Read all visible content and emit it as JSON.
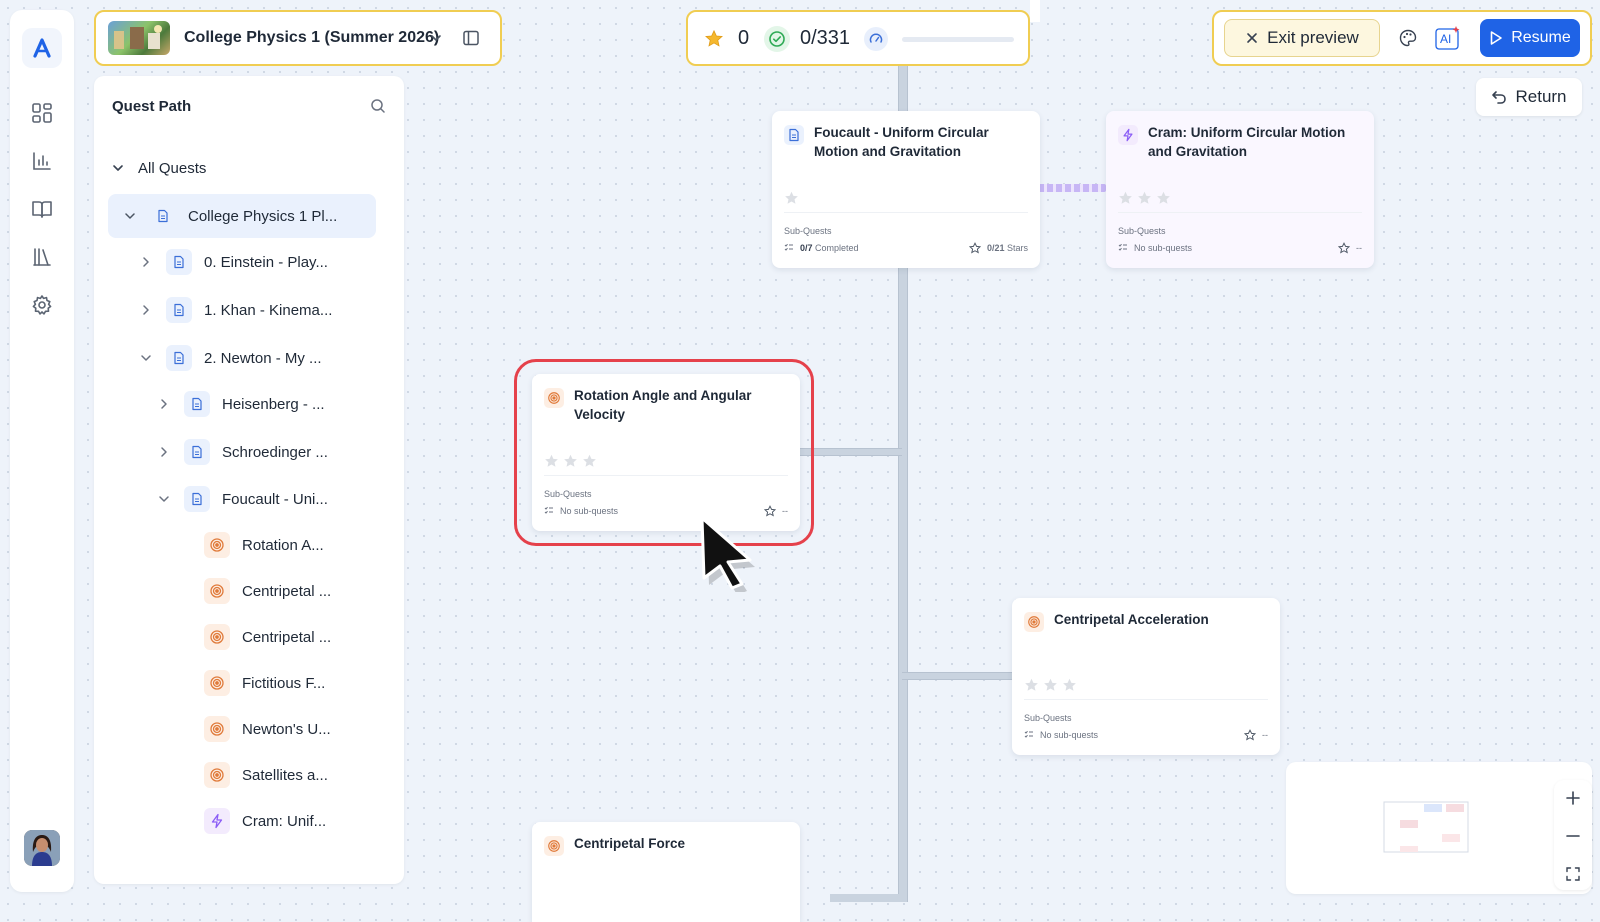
{
  "course": {
    "title": "College Physics 1 (Summer 2026)"
  },
  "stats": {
    "stars": "0",
    "completed": "0/331",
    "progress_fraction": 0
  },
  "actions": {
    "exit_preview": "Exit preview",
    "resume": "Resume",
    "return": "Return",
    "ai_label": "AI"
  },
  "panel": {
    "title": "Quest Path",
    "all_quests": "All Quests",
    "items": [
      {
        "label": "College Physics 1 Pl...",
        "icon": "doc-icon"
      },
      {
        "label": "0. Einstein - Play...",
        "icon": "doc-icon"
      },
      {
        "label": "1. Khan - Kinema...",
        "icon": "doc-icon"
      },
      {
        "label": "2. Newton - My ...",
        "icon": "doc-icon"
      },
      {
        "label": "Heisenberg - ...",
        "icon": "doc-icon"
      },
      {
        "label": "Schroedinger ...",
        "icon": "doc-icon"
      },
      {
        "label": "Foucault - Uni...",
        "icon": "doc-icon"
      },
      {
        "label": "Rotation A...",
        "icon": "target-icon"
      },
      {
        "label": "Centripetal ...",
        "icon": "target-icon"
      },
      {
        "label": "Centripetal ...",
        "icon": "target-icon"
      },
      {
        "label": "Fictitious F...",
        "icon": "target-icon"
      },
      {
        "label": "Newton's U...",
        "icon": "target-icon"
      },
      {
        "label": "Satellites a...",
        "icon": "target-icon"
      },
      {
        "label": "Cram: Unif...",
        "icon": "bolt-icon"
      }
    ]
  },
  "cards": {
    "foucault": {
      "title": "Foucault - Uniform Circular Motion and Gravitation",
      "sub_label": "Sub-Quests",
      "completed_count": "0/7",
      "completed_word": "Completed",
      "stars_count": "0/21",
      "stars_word": "Stars"
    },
    "cram": {
      "title": "Cram: Uniform Circular Motion and Gravitation",
      "sub_label": "Sub-Quests",
      "sub_text": "No sub-quests",
      "right": "--"
    },
    "rotation": {
      "title": "Rotation Angle and Angular Velocity",
      "sub_label": "Sub-Quests",
      "sub_text": "No sub-quests",
      "right": "--"
    },
    "centripetal_accel": {
      "title": "Centripetal Acceleration",
      "sub_label": "Sub-Quests",
      "sub_text": "No sub-quests",
      "right": "--"
    },
    "centripetal_force": {
      "title": "Centripetal Force"
    }
  },
  "colors": {
    "accent": "#1f63e6",
    "highlight": "#e5414b",
    "frame": "#f0cd52",
    "target": "#e07a3a",
    "bolt": "#8b5cf6"
  }
}
